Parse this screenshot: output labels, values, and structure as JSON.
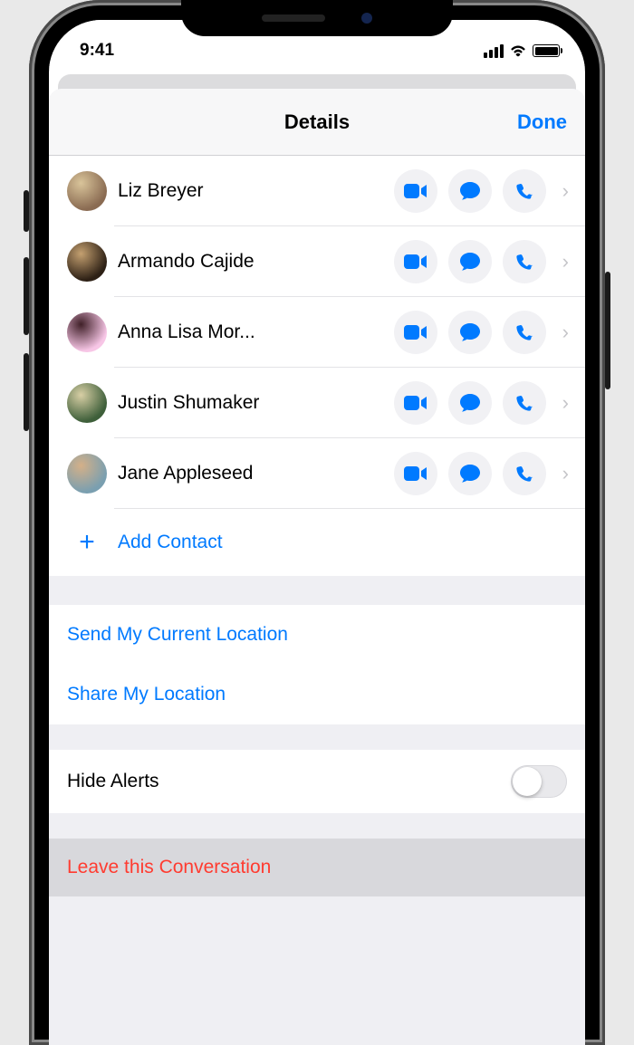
{
  "statusbar": {
    "time": "9:41"
  },
  "header": {
    "title": "Details",
    "done": "Done"
  },
  "colors": {
    "accent": "#007aff",
    "destructive": "#ff3b30",
    "icon_bg": "#f1f1f4"
  },
  "contacts": [
    {
      "name": "Liz Breyer",
      "avatar": {
        "bg1": "#8a6b52",
        "bg2": "#d9c49a"
      }
    },
    {
      "name": "Armando Cajide",
      "avatar": {
        "bg1": "#2d2015",
        "bg2": "#c4a070"
      }
    },
    {
      "name": "Anna Lisa Mor...",
      "avatar": {
        "bg1": "#f7c6e6",
        "bg2": "#402028"
      }
    },
    {
      "name": "Justin Shumaker",
      "avatar": {
        "bg1": "#3e5f3a",
        "bg2": "#d8cfa5"
      }
    },
    {
      "name": "Jane Appleseed",
      "avatar": {
        "bg1": "#7a9fb0",
        "bg2": "#d4b088"
      }
    }
  ],
  "add_contact": "Add Contact",
  "location": {
    "send": "Send My Current Location",
    "share": "Share My Location"
  },
  "alerts": {
    "label": "Hide Alerts",
    "on": false
  },
  "leave": "Leave this Conversation"
}
